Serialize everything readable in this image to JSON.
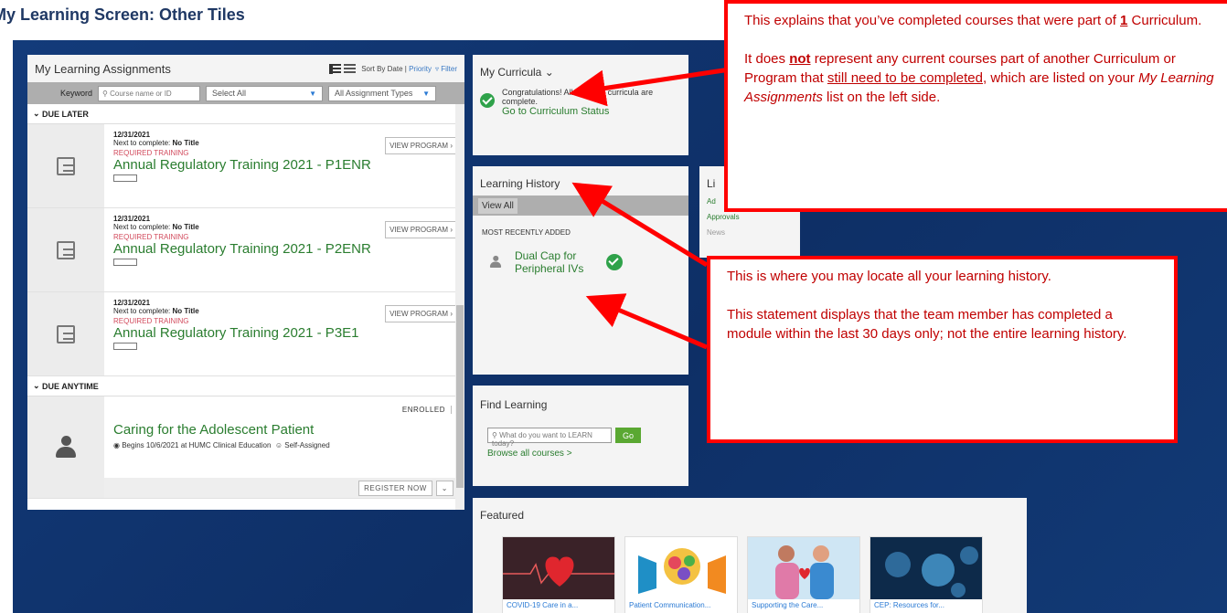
{
  "heading": "My Learning Screen: Other Tiles",
  "assignments": {
    "title": "My Learning Assignments",
    "sort_label": "Sort By Date |",
    "sort_priority": "Priority",
    "filter_label": "Filter",
    "keyword_label": "Keyword",
    "search_placeholder": "Course name or ID",
    "select_all": "Select All",
    "types": "All Assignment Types",
    "due_later": "DUE LATER",
    "due_anytime": "DUE ANYTIME",
    "rows": [
      {
        "date": "12/31/2021",
        "next": "Next to complete:",
        "next_title": "No Title",
        "req": "REQUIRED TRAINING",
        "name": "Annual Regulatory Training 2021 - P1ENR",
        "action": "VIEW PROGRAM"
      },
      {
        "date": "12/31/2021",
        "next": "Next to complete:",
        "next_title": "No Title",
        "req": "REQUIRED TRAINING",
        "name": "Annual Regulatory Training 2021 - P2ENR",
        "action": "VIEW PROGRAM"
      },
      {
        "date": "12/31/2021",
        "next": "Next to complete:",
        "next_title": "No Title",
        "req": "REQUIRED TRAINING",
        "name": "Annual Regulatory Training 2021 - P3E1",
        "action": "VIEW PROGRAM"
      }
    ],
    "anytime": {
      "status": "ENROLLED",
      "name": "Caring for the Adolescent Patient",
      "begins": "Begins 10/6/2021 at HUMC Clinical Education",
      "assigned": "Self-Assigned",
      "register": "REGISTER NOW"
    }
  },
  "curricula": {
    "title": "My Curricula",
    "message": "Congratulations! All required curricula are complete.",
    "link": "Go to Curriculum Status"
  },
  "history": {
    "title": "Learning History",
    "view_all": "View All",
    "recent_label": "MOST RECENTLY ADDED",
    "item": "Dual Cap for Peripheral IVs"
  },
  "library": {
    "items": [
      "Approvals",
      "News"
    ]
  },
  "find": {
    "title": "Find Learning",
    "placeholder": "What do you want to LEARN today?",
    "go": "Go",
    "browse": "Browse all courses >"
  },
  "featured": {
    "title": "Featured",
    "cards": [
      "COVID-19 Care in a...",
      "Patient Communication...",
      "Supporting the Care...",
      "CEP: Resources for..."
    ]
  },
  "callouts": {
    "c1_p1_a": "This explains that you’ve completed courses that were part of ",
    "c1_p1_num": "1",
    "c1_p1_b": " Curriculum.",
    "c1_p2_a": "It does ",
    "c1_p2_not": "not",
    "c1_p2_b": " represent any current courses part of another Curriculum or Program that ",
    "c1_p2_u": "still need to be completed",
    "c1_p2_c": ", which are listed on your ",
    "c1_p2_i": "My Learning Assignments",
    "c1_p2_d": " list on the left side.",
    "c2_p1": "This is where you may locate all your learning history.",
    "c2_p2": "This statement displays that the team member has completed a module within the last 30 days only; not the entire learning history."
  }
}
